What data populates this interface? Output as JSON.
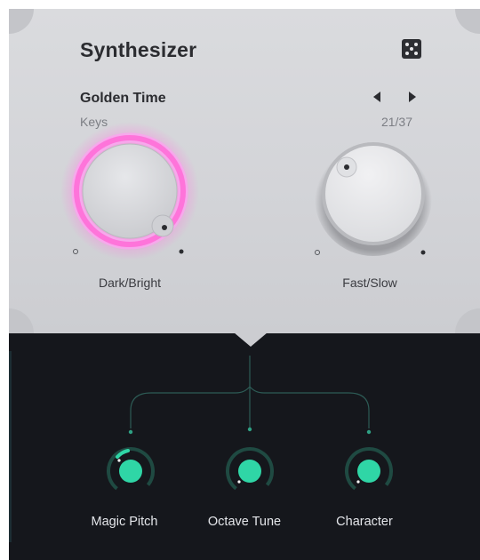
{
  "plugin": {
    "title": "Synthesizer",
    "dice_icon": "dice-icon"
  },
  "preset": {
    "name": "Golden Time",
    "category": "Keys",
    "counter": "21/37",
    "prev_icon": "arrow-left-icon",
    "next_icon": "arrow-right-icon"
  },
  "main_knobs": [
    {
      "label": "Dark/Bright",
      "highlighted": true
    },
    {
      "label": "Fast/Slow",
      "highlighted": false
    }
  ],
  "macro_knobs": [
    {
      "label": "Magic Pitch"
    },
    {
      "label": "Octave Tune"
    },
    {
      "label": "Character"
    }
  ],
  "colors": {
    "panel": "#d3d4d8",
    "background": "#15171c",
    "accent_pink": "#ff6fd8",
    "accent_teal": "#2fd6a6"
  }
}
